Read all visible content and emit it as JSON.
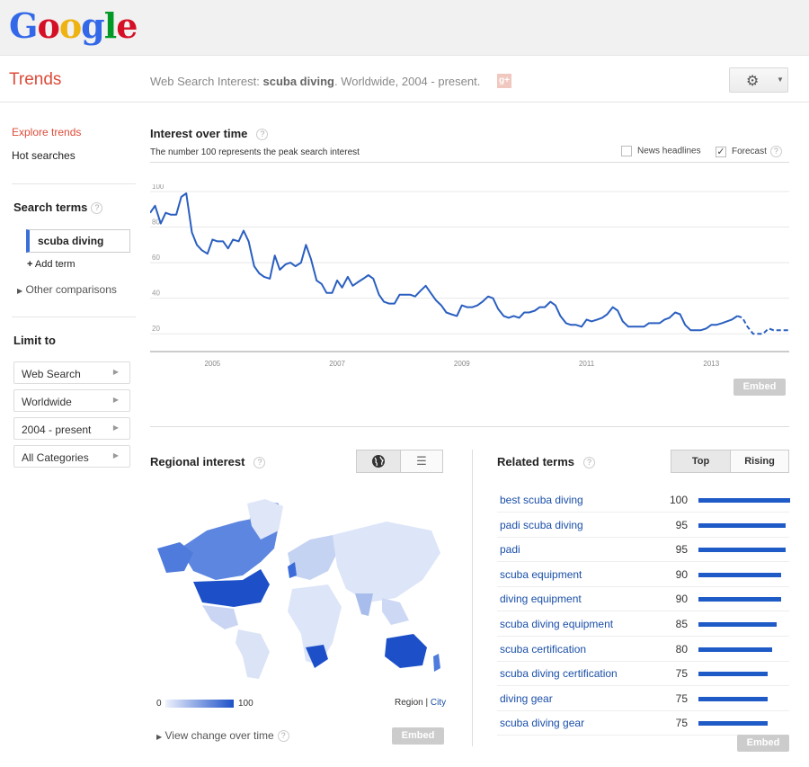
{
  "logo": "Google",
  "app_title": "Trends",
  "search_desc": {
    "prefix": "Web Search Interest: ",
    "term": "scuba diving",
    "suffix": ". Worldwide, 2004 - present."
  },
  "left_nav": {
    "explore": "Explore trends",
    "hot": "Hot searches",
    "search_terms_title": "Search terms",
    "term": "scuba diving",
    "add_term": "Add term",
    "other_comparisons": "Other comparisons",
    "limit_to": "Limit to",
    "filters": [
      "Web Search",
      "Worldwide",
      "2004 - present",
      "All Categories"
    ]
  },
  "interest": {
    "title": "Interest over time",
    "subtitle": "The number 100 represents the peak search interest",
    "news_headlines": "News headlines",
    "forecast": "Forecast",
    "embed": "Embed"
  },
  "regional": {
    "title": "Regional interest",
    "scale_min": "0",
    "scale_max": "100",
    "region": "Region",
    "city": "City",
    "view_change": "View change over time",
    "embed": "Embed"
  },
  "related": {
    "title": "Related terms",
    "tab_top": "Top",
    "tab_rising": "Rising",
    "embed": "Embed",
    "items": [
      {
        "term": "best scuba diving",
        "value": 100
      },
      {
        "term": "padi scuba diving",
        "value": 95
      },
      {
        "term": "padi",
        "value": 95
      },
      {
        "term": "scuba equipment",
        "value": 90
      },
      {
        "term": "diving equipment",
        "value": 90
      },
      {
        "term": "scuba diving equipment",
        "value": 85
      },
      {
        "term": "scuba certification",
        "value": 80
      },
      {
        "term": "scuba diving certification",
        "value": 75
      },
      {
        "term": "diving gear",
        "value": 75
      },
      {
        "term": "scuba diving gear",
        "value": 75
      }
    ]
  },
  "chart_data": {
    "type": "line",
    "title": "Interest over time",
    "xlabel": "",
    "ylabel": "",
    "y_ticks": [
      20,
      40,
      60,
      80,
      100
    ],
    "x_ticks": [
      "2005",
      "2007",
      "2009",
      "2011",
      "2013"
    ],
    "ylim": [
      10,
      100
    ],
    "xlim": [
      2004.0,
      2014.25
    ],
    "series": [
      {
        "values": [
          [
            2004.0,
            88
          ],
          [
            2004.08,
            92
          ],
          [
            2004.17,
            82
          ],
          [
            2004.25,
            88
          ],
          [
            2004.33,
            87
          ],
          [
            2004.42,
            87
          ],
          [
            2004.5,
            97
          ],
          [
            2004.58,
            99
          ],
          [
            2004.67,
            77
          ],
          [
            2004.75,
            70
          ],
          [
            2004.83,
            67
          ],
          [
            2004.92,
            65
          ],
          [
            2005.0,
            73
          ],
          [
            2005.08,
            72
          ],
          [
            2005.17,
            72
          ],
          [
            2005.25,
            68
          ],
          [
            2005.33,
            73
          ],
          [
            2005.42,
            72
          ],
          [
            2005.5,
            78
          ],
          [
            2005.58,
            72
          ],
          [
            2005.67,
            58
          ],
          [
            2005.75,
            54
          ],
          [
            2005.83,
            52
          ],
          [
            2005.92,
            51
          ],
          [
            2006.0,
            64
          ],
          [
            2006.08,
            56
          ],
          [
            2006.17,
            59
          ],
          [
            2006.25,
            60
          ],
          [
            2006.33,
            58
          ],
          [
            2006.42,
            60
          ],
          [
            2006.5,
            70
          ],
          [
            2006.58,
            62
          ],
          [
            2006.67,
            50
          ],
          [
            2006.75,
            48
          ],
          [
            2006.83,
            43
          ],
          [
            2006.92,
            43
          ],
          [
            2007.0,
            50
          ],
          [
            2007.08,
            46
          ],
          [
            2007.17,
            52
          ],
          [
            2007.25,
            47
          ],
          [
            2007.33,
            49
          ],
          [
            2007.42,
            51
          ],
          [
            2007.5,
            53
          ],
          [
            2007.58,
            51
          ],
          [
            2007.67,
            42
          ],
          [
            2007.75,
            38
          ],
          [
            2007.83,
            37
          ],
          [
            2007.92,
            37
          ],
          [
            2008.0,
            42
          ],
          [
            2008.08,
            42
          ],
          [
            2008.17,
            42
          ],
          [
            2008.25,
            41
          ],
          [
            2008.33,
            44
          ],
          [
            2008.42,
            47
          ],
          [
            2008.5,
            43
          ],
          [
            2008.58,
            39
          ],
          [
            2008.67,
            36
          ],
          [
            2008.75,
            32
          ],
          [
            2008.83,
            31
          ],
          [
            2008.92,
            30
          ],
          [
            2009.0,
            36
          ],
          [
            2009.08,
            35
          ],
          [
            2009.17,
            35
          ],
          [
            2009.25,
            36
          ],
          [
            2009.33,
            38
          ],
          [
            2009.42,
            41
          ],
          [
            2009.5,
            40
          ],
          [
            2009.58,
            34
          ],
          [
            2009.67,
            30
          ],
          [
            2009.75,
            29
          ],
          [
            2009.83,
            30
          ],
          [
            2009.92,
            29
          ],
          [
            2010.0,
            32
          ],
          [
            2010.08,
            32
          ],
          [
            2010.17,
            33
          ],
          [
            2010.25,
            35
          ],
          [
            2010.33,
            35
          ],
          [
            2010.42,
            38
          ],
          [
            2010.5,
            36
          ],
          [
            2010.58,
            30
          ],
          [
            2010.67,
            26
          ],
          [
            2010.75,
            25
          ],
          [
            2010.83,
            25
          ],
          [
            2010.92,
            24
          ],
          [
            2011.0,
            28
          ],
          [
            2011.08,
            27
          ],
          [
            2011.17,
            28
          ],
          [
            2011.25,
            29
          ],
          [
            2011.33,
            31
          ],
          [
            2011.42,
            35
          ],
          [
            2011.5,
            33
          ],
          [
            2011.58,
            27
          ],
          [
            2011.67,
            24
          ],
          [
            2011.75,
            24
          ],
          [
            2011.83,
            24
          ],
          [
            2011.92,
            24
          ],
          [
            2012.0,
            26
          ],
          [
            2012.08,
            26
          ],
          [
            2012.17,
            26
          ],
          [
            2012.25,
            28
          ],
          [
            2012.33,
            29
          ],
          [
            2012.42,
            32
          ],
          [
            2012.5,
            31
          ],
          [
            2012.58,
            25
          ],
          [
            2012.67,
            22
          ],
          [
            2012.75,
            22
          ],
          [
            2012.83,
            22
          ],
          [
            2012.92,
            23
          ],
          [
            2013.0,
            25
          ],
          [
            2013.08,
            25
          ],
          [
            2013.17,
            26
          ],
          [
            2013.25,
            27
          ],
          [
            2013.33,
            28
          ],
          [
            2013.42,
            30
          ]
        ]
      },
      {
        "name": "Forecast",
        "values": [
          [
            2013.42,
            30
          ],
          [
            2013.5,
            29
          ],
          [
            2013.58,
            24
          ],
          [
            2013.67,
            20
          ],
          [
            2013.75,
            20
          ],
          [
            2013.83,
            20
          ],
          [
            2013.92,
            23
          ],
          [
            2014.0,
            22
          ],
          [
            2014.08,
            22
          ],
          [
            2014.17,
            22
          ],
          [
            2014.25,
            22
          ]
        ]
      }
    ]
  },
  "colors": {
    "line": "#2a5fc0",
    "accent_red": "#dd4b39",
    "link_blue": "#1a4fa8",
    "bar_blue": "#1f5bc6"
  }
}
